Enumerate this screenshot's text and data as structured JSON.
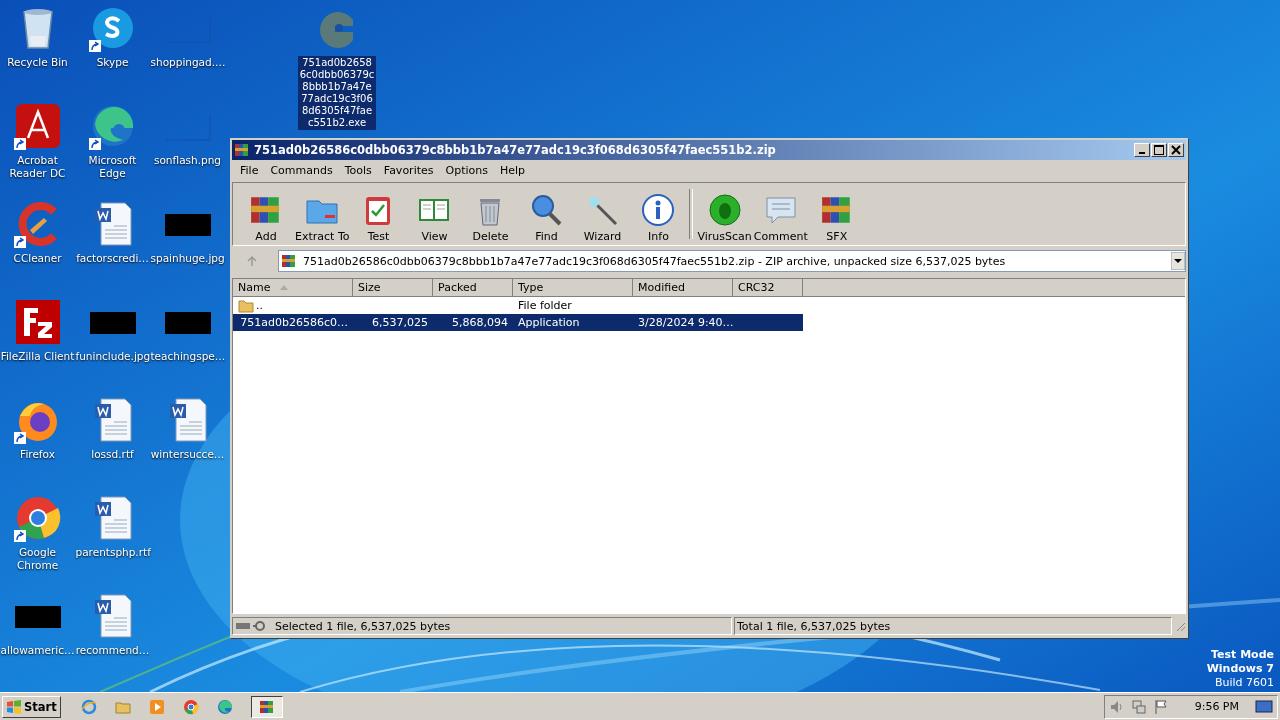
{
  "desktop": {
    "columns": [
      [
        {
          "label": "Recycle Bin",
          "kind": "recycle",
          "shortcut": false
        },
        {
          "label": "Acrobat Reader DC",
          "kind": "acrobat",
          "shortcut": true
        },
        {
          "label": "CCleaner",
          "kind": "ccleaner",
          "shortcut": true
        },
        {
          "label": "FileZilla Client",
          "kind": "filezilla",
          "shortcut": false
        },
        {
          "label": "Firefox",
          "kind": "firefox",
          "shortcut": true
        },
        {
          "label": "Google Chrome",
          "kind": "chrome",
          "shortcut": true
        },
        {
          "label": "allowameric…",
          "kind": "black",
          "shortcut": false
        }
      ],
      [
        {
          "label": "Skype",
          "kind": "skype",
          "shortcut": true
        },
        {
          "label": "Microsoft Edge",
          "kind": "edge",
          "shortcut": true
        },
        {
          "label": "factorscredi…",
          "kind": "word",
          "shortcut": false
        },
        {
          "label": "funinclude.jpg",
          "kind": "black",
          "shortcut": false
        },
        {
          "label": "lossd.rtf",
          "kind": "word",
          "shortcut": false
        },
        {
          "label": "parentsphp.rtf",
          "kind": "word",
          "shortcut": false
        },
        {
          "label": "recommend…",
          "kind": "word",
          "shortcut": false
        }
      ],
      [
        {
          "label": "shoppingad.…",
          "kind": "blank",
          "shortcut": false
        },
        {
          "label": "sonflash.png",
          "kind": "blank",
          "shortcut": false
        },
        {
          "label": "spainhuge.jpg",
          "kind": "black",
          "shortcut": false
        },
        {
          "label": "teachingspe…",
          "kind": "black",
          "shortcut": false
        },
        {
          "label": "wintersucce…",
          "kind": "word",
          "shortcut": false
        }
      ]
    ],
    "selected_icon": {
      "lines": [
        "751ad0b2658",
        "6c0dbb06379c",
        "8bbb1b7a47e",
        "77adc19c3f06",
        "8d6305f47fae",
        "c551b2.exe"
      ],
      "selected": true
    },
    "watermark_text": [
      "Test Mode",
      "Windows 7",
      "Build 7601"
    ]
  },
  "window": {
    "title": "751ad0b26586c0dbb06379c8bbb1b7a47e77adc19c3f068d6305f47faec551b2.zip",
    "menu": [
      "File",
      "Commands",
      "Tools",
      "Favorites",
      "Options",
      "Help"
    ],
    "toolbar": [
      {
        "label": "Add",
        "kind": "add"
      },
      {
        "label": "Extract To",
        "kind": "extract"
      },
      {
        "label": "Test",
        "kind": "test"
      },
      {
        "label": "View",
        "kind": "view"
      },
      {
        "label": "Delete",
        "kind": "delete"
      },
      {
        "label": "Find",
        "kind": "find"
      },
      {
        "label": "Wizard",
        "kind": "wizard"
      },
      {
        "label": "Info",
        "kind": "info"
      },
      {
        "label": "VirusScan",
        "kind": "virus"
      },
      {
        "label": "Comment",
        "kind": "comment"
      },
      {
        "label": "SFX",
        "kind": "add"
      }
    ],
    "address": "751ad0b26586c0dbb06379c8bbb1b7a47e77adc19c3f068d6305f47faec551b2.zip - ZIP archive, unpacked size 6,537,025 bytes",
    "columns": [
      "Name",
      "Size",
      "Packed",
      "Type",
      "Modified",
      "CRC32"
    ],
    "rows": [
      {
        "kind": "folder",
        "selected": false,
        "name": "..",
        "type": "File folder"
      },
      {
        "kind": "file",
        "selected": true,
        "name": "751ad0b26586c0…",
        "size": "6,537,025",
        "packed": "5,868,094",
        "type": "Application",
        "modified": "3/28/2024 9:40…"
      }
    ],
    "status_left": "Selected 1 file, 6,537,025 bytes",
    "status_right": "Total 1 file, 6,537,025 bytes"
  },
  "taskbar": {
    "start": "Start",
    "quick_launch": [
      {
        "kind": "ie"
      },
      {
        "kind": "explorer"
      },
      {
        "kind": "media"
      },
      {
        "kind": "chrome"
      },
      {
        "kind": "edge"
      }
    ],
    "tasks": [
      {
        "kind": "winrar",
        "selected": true
      }
    ],
    "time": "9:56 PM"
  }
}
